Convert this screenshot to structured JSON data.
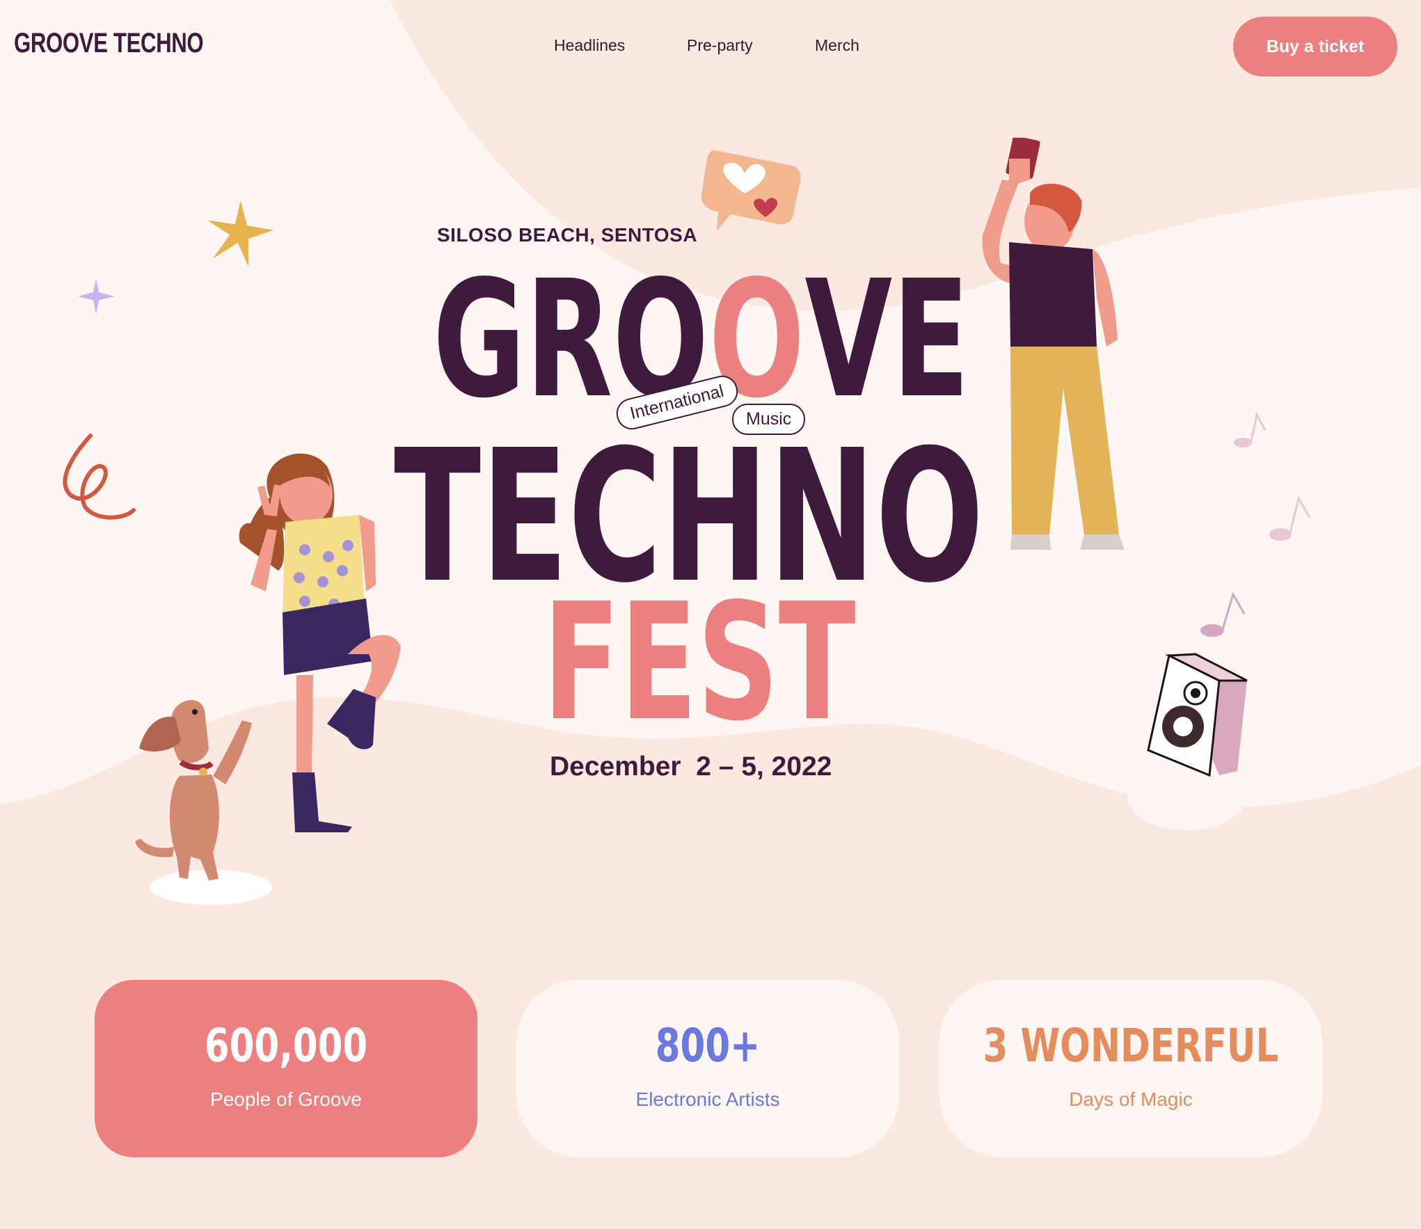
{
  "header": {
    "logo": "GROOVE TECHNO",
    "nav": [
      {
        "label": "Headlines"
      },
      {
        "label": "Pre-party"
      },
      {
        "label": "Merch"
      }
    ],
    "cta": "Buy a ticket"
  },
  "hero": {
    "venue": "SILOSO BEACH, SENTOSA",
    "title_line1": "GROOVE",
    "title_line2": "TECHNO",
    "title_line3": "FEST",
    "tag1": "International",
    "tag2": "Music",
    "date": "December  2 – 5, 2022"
  },
  "stats": [
    {
      "value": "600,000",
      "label": "People of Groove"
    },
    {
      "value": "800+",
      "label": "Electronic Artists"
    },
    {
      "value": "3 WONDERFUL",
      "label": "Days of Magic"
    }
  ],
  "colors": {
    "background": "#fbe9e1",
    "light": "#fdf6f3",
    "primary_dark": "#3e1a3c",
    "accent_pink": "#ec7f80",
    "accent_blue": "#6b78dd",
    "accent_orange": "#e48c5e"
  },
  "icons": [
    "heart-chat-icon",
    "star-icon",
    "sparkle-icon",
    "squiggle-icon",
    "music-note-icon",
    "speaker-icon"
  ]
}
